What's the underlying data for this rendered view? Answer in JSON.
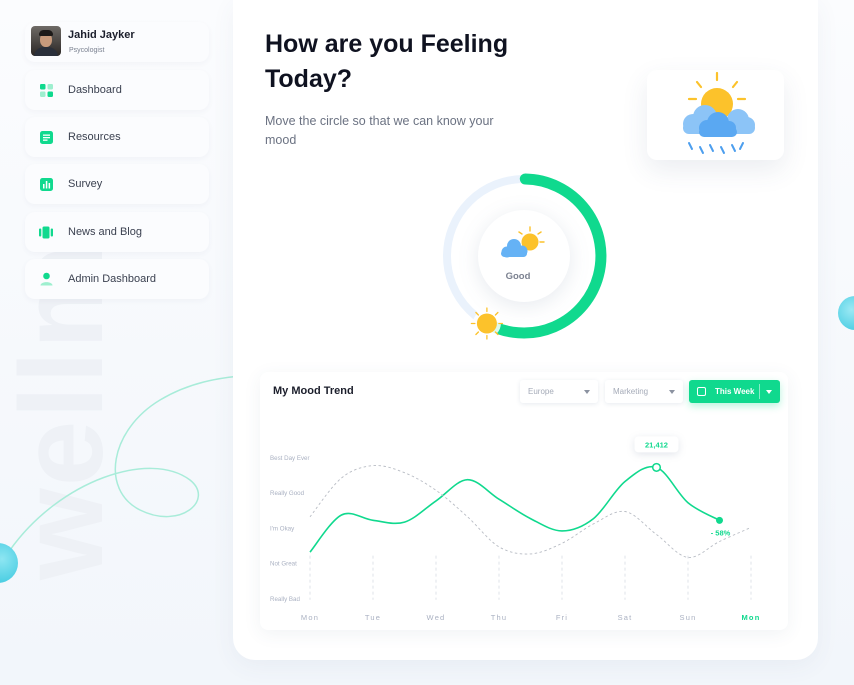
{
  "watermark_text": "wellm",
  "profile": {
    "name": "Jahid Jayker",
    "role": "Psycologist"
  },
  "nav": {
    "items": [
      {
        "label": "Dashboard",
        "icon": "grid-icon"
      },
      {
        "label": "Resources",
        "icon": "document-icon"
      },
      {
        "label": "Survey",
        "icon": "bar-chart-icon"
      },
      {
        "label": "News and Blog",
        "icon": "cards-icon"
      },
      {
        "label": "Admin Dashboard",
        "icon": "user-icon"
      }
    ]
  },
  "hero": {
    "title": "How are you Feeling Today?",
    "subtitle": "Move the circle so that we can know your mood",
    "mood": "Good",
    "mood_level": 0.58,
    "weather_icon": "sun-cloud-rain-icon"
  },
  "trend": {
    "title": "My Mood Trend",
    "filters": {
      "region": "Europe",
      "department": "Marketing",
      "period": "This Week"
    },
    "peak_label": "21,412",
    "change_label": "- 58%"
  },
  "colors": {
    "accent": "#10d98e",
    "accent_light": "#e9f1fb",
    "sun": "#fcc22b",
    "cloud": "#65b2f5"
  },
  "chart_data": {
    "type": "line",
    "title": "My Mood Trend",
    "categories": [
      "Mon",
      "Tue",
      "Wed",
      "Thu",
      "Fri",
      "Sat",
      "Sun",
      "Mon"
    ],
    "y_levels": [
      "Best Day Ever",
      "Really Good",
      "I'm Okay",
      "Not Great",
      "Really Bad"
    ],
    "ylim": [
      0,
      4
    ],
    "highlight_category": "Mon",
    "series": [
      {
        "style": "solid",
        "color": "#10d98e",
        "x": [
          0,
          0.5,
          1,
          1.5,
          2,
          2.5,
          3,
          3.5,
          4,
          4.5,
          5,
          5.5,
          6,
          6.5
        ],
        "values": [
          1.3,
          2.35,
          2.2,
          2.15,
          2.75,
          3.35,
          2.8,
          2.25,
          1.9,
          2.25,
          3.3,
          3.7,
          2.7,
          2.2
        ]
      },
      {
        "style": "dashed",
        "color": "#b8bcc4",
        "x": [
          0,
          0.5,
          1,
          1.5,
          2,
          2.5,
          3,
          3.5,
          4,
          4.5,
          5,
          5.5,
          6,
          6.5,
          7
        ],
        "values": [
          2.3,
          3.4,
          3.75,
          3.55,
          3.05,
          2.3,
          1.45,
          1.25,
          1.55,
          2.1,
          2.45,
          1.8,
          1.15,
          1.6,
          2.0
        ]
      }
    ],
    "annotations": [
      {
        "x": 5.5,
        "y": 3.7,
        "label": "21,412"
      },
      {
        "x": 6.5,
        "y": 2.2,
        "label": "- 58%"
      }
    ]
  }
}
